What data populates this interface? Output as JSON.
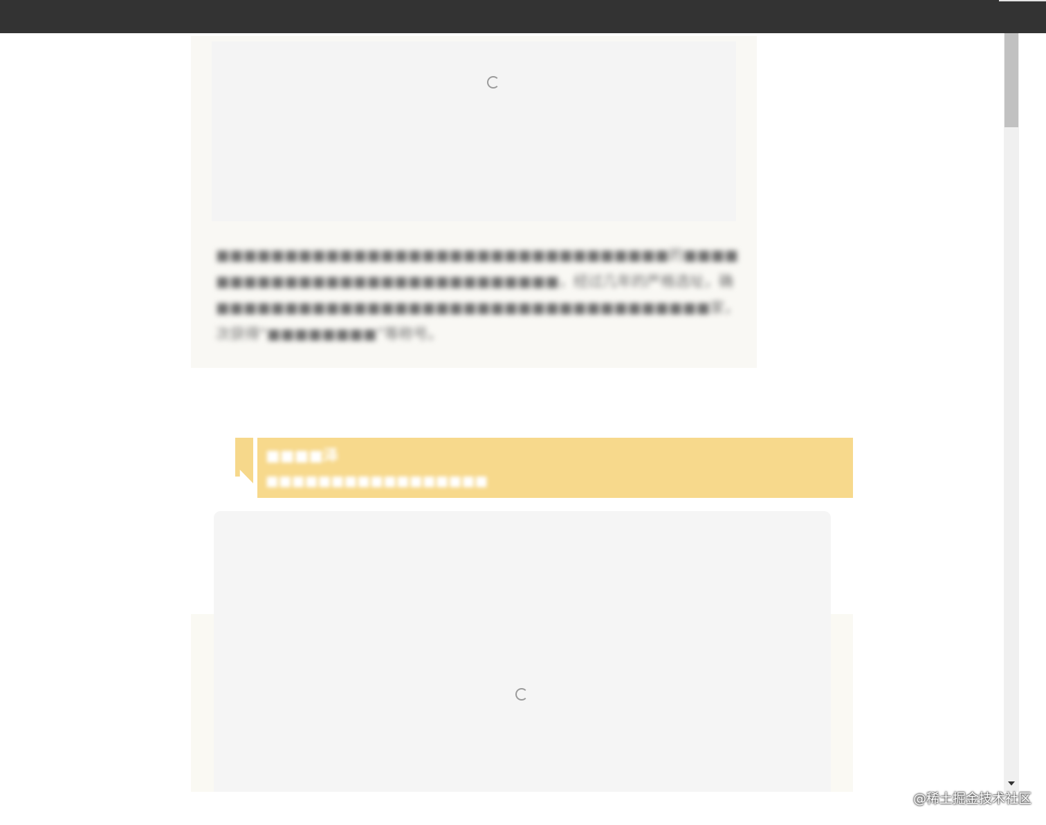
{
  "article": {
    "paragraph_lines": [
      "■■■■■■■■■■■■■■■■■■■■■■■■■■■■■■■■■的■■■■。",
      "■■■■■■■■■■■■■■■■■■■■■■■■■，经过几年的严格选址，确",
      "■■■■■■■■■■■■■■■■■■■■■■■■■■■■■■■■■■■■家，并多",
      "次获得“■■■■■■■■”等称号。"
    ]
  },
  "section": {
    "title": "■■■■泽",
    "subtitle": "■■■■■■■■■■■■■■■■■"
  },
  "watermark": {
    "text": "@稀土掘金技术社区"
  },
  "colors": {
    "topbar": "#333333",
    "accent": "#f7d98c",
    "card_background": "#f9f8f4",
    "placeholder": "#f4f4f4"
  },
  "icons": {
    "loading": "loading-spinner-icon",
    "scroll_down": "scroll-down-arrow-icon"
  }
}
